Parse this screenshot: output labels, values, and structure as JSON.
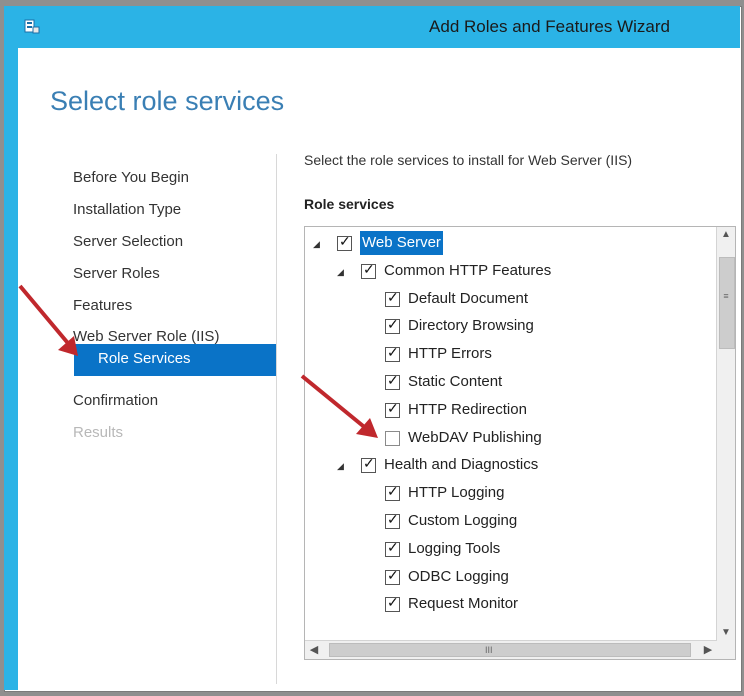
{
  "window": {
    "title": "Add Roles and Features Wizard"
  },
  "page": {
    "title": "Select role services",
    "intro": "Select the role services to install for Web Server (IIS)",
    "section_label": "Role services"
  },
  "nav": {
    "items": [
      {
        "label": "Before You Begin"
      },
      {
        "label": "Installation Type"
      },
      {
        "label": "Server Selection"
      },
      {
        "label": "Server Roles"
      },
      {
        "label": "Features"
      },
      {
        "label": "Web Server Role (IIS)"
      },
      {
        "label": "Role Services"
      },
      {
        "label": "Confirmation"
      },
      {
        "label": "Results"
      }
    ]
  },
  "tree": {
    "items": [
      {
        "label": "Web Server",
        "checked": true,
        "expander": "◢",
        "level": 0,
        "selected": true
      },
      {
        "label": "Common HTTP Features",
        "checked": true,
        "expander": "◢",
        "level": 1
      },
      {
        "label": "Default Document",
        "checked": true,
        "level": 2
      },
      {
        "label": "Directory Browsing",
        "checked": true,
        "level": 2
      },
      {
        "label": "HTTP Errors",
        "checked": true,
        "level": 2
      },
      {
        "label": "Static Content",
        "checked": true,
        "level": 2
      },
      {
        "label": "HTTP Redirection",
        "checked": true,
        "level": 2
      },
      {
        "label": "WebDAV Publishing",
        "checked": false,
        "level": 2
      },
      {
        "label": "Health and Diagnostics",
        "checked": true,
        "expander": "◢",
        "level": 1
      },
      {
        "label": "HTTP Logging",
        "checked": true,
        "level": 2
      },
      {
        "label": "Custom Logging",
        "checked": true,
        "level": 2
      },
      {
        "label": "Logging Tools",
        "checked": true,
        "level": 2
      },
      {
        "label": "ODBC Logging",
        "checked": true,
        "level": 2
      },
      {
        "label": "Request Monitor",
        "checked": true,
        "level": 2
      }
    ]
  },
  "scrollbar": {
    "grip_vertical": "≡",
    "grip_horizontal": "III",
    "up": "^",
    "down": "v",
    "left": "<",
    "right": ">"
  },
  "colors": {
    "title_bar": "#2bb3e6",
    "page_title": "#3a7fb4",
    "selection": "#0a73c7",
    "annotation_arrow": "#c0282d"
  }
}
